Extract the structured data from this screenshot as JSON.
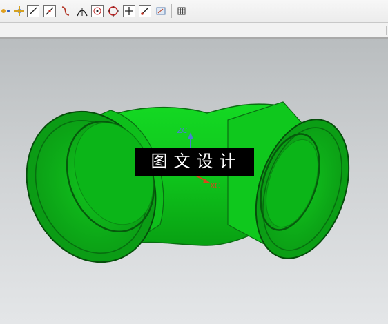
{
  "toolbar": {
    "icons": [
      "snap-icon",
      "move-icon",
      "line-icon",
      "line-icon",
      "curve-icon",
      "arc-icon",
      "circle-center-icon",
      "circle-icon",
      "point-icon",
      "line-icon",
      "view-icon",
      "grid-icon"
    ]
  },
  "viewport": {
    "watermark": "图文设计",
    "axes": {
      "z_label": "ZC",
      "x_label": "XC"
    },
    "colors": {
      "model_green": "#0fc51c",
      "model_dark_green": "#087a10",
      "z_axis": "#4a7fd0",
      "x_axis": "#d9451c",
      "background_top": "#b9bdbf",
      "background_bottom": "#e4e6e8"
    }
  }
}
